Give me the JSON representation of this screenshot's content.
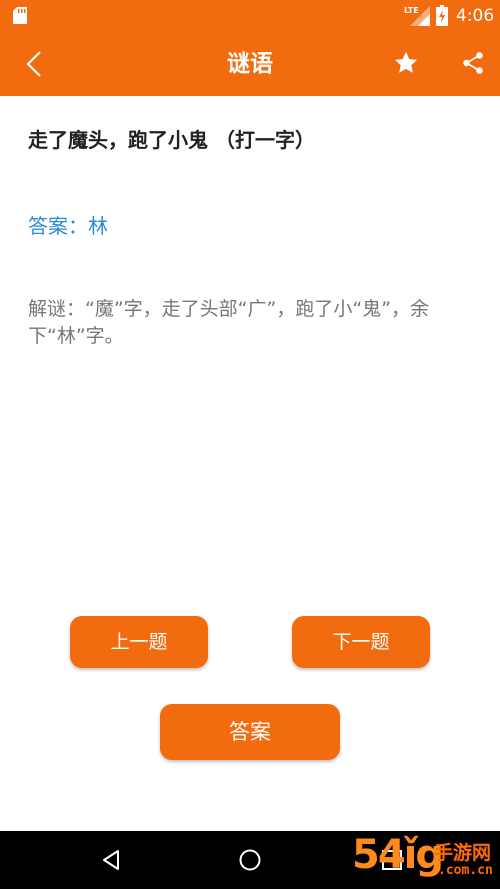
{
  "status_bar": {
    "network": "LTE",
    "time": "4:06"
  },
  "app_bar": {
    "title": "谜语",
    "icons": [
      "back-arrow-icon",
      "star-icon",
      "share-icon"
    ]
  },
  "riddle": {
    "question": "走了魔头，跑了小鬼 （打一字）",
    "answer": "答案：林",
    "explanation": "解谜：“魔”字，走了头部“广”，跑了小“鬼”，余下“林”字。"
  },
  "buttons": {
    "prev_label": "上一题",
    "next_label": "下一题",
    "answer_label": "答案"
  },
  "watermark": {
    "logo_text": "54ǐg",
    "site_name": "手游网",
    "domain": ".com.cn"
  },
  "colors": {
    "primary": "#f26b0f",
    "answer_text": "#2a8bd6",
    "explanation_text": "#777777",
    "watermark": "#ff6a00"
  }
}
